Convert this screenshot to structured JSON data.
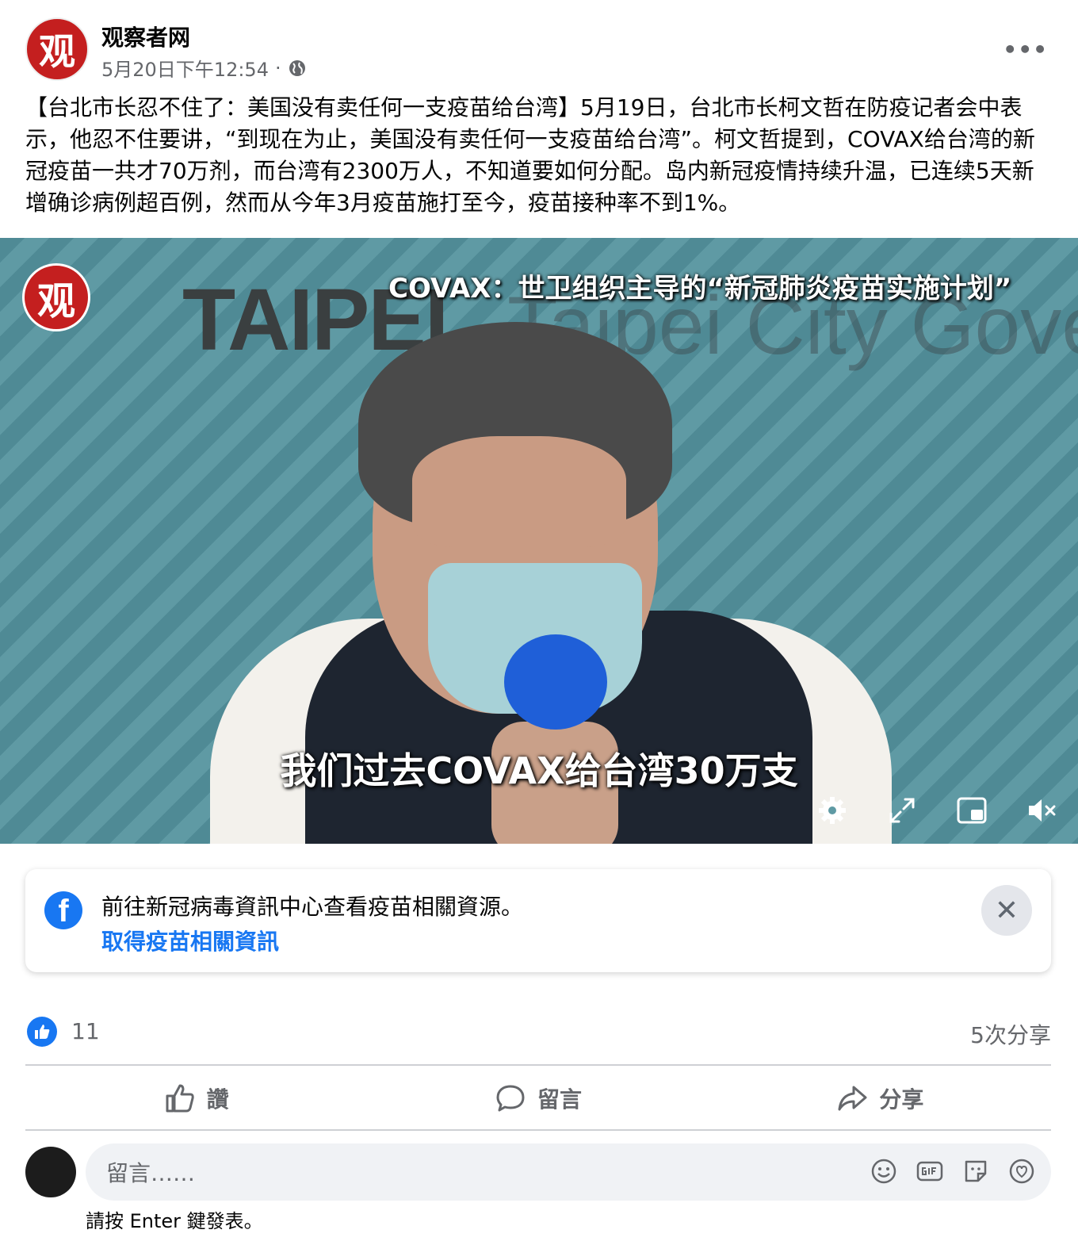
{
  "header": {
    "avatar_text": "观",
    "page_name": "观察者网",
    "timestamp": "5月20日下午12:54",
    "separator": "·",
    "privacy_icon": "globe-icon",
    "more_icon": "more-options-icon",
    "more_label": "•••"
  },
  "post": {
    "text": "【台北市长忍不住了：美国没有卖任何一支疫苗给台湾】5月19日，台北市长柯文哲在防疫记者会中表示，他忍不住要讲，“到现在为止，美国没有卖任何一支疫苗给台湾”。柯文哲提到，COVAX给台湾的新冠疫苗一共才70万剂，而台湾有2300万人，不知道要如何分配。岛内新冠疫情持续升温，已连续5天新增确诊病例超百例，然而从今年3月疫苗施打至今，疫苗接种率不到1%。"
  },
  "video": {
    "logo_text": "观",
    "backdrop_text": "TAIPEI",
    "backdrop_text_2": "Taipei City Gover",
    "top_caption": "COVAX：世卫组织主导的“新冠肺炎疫苗实施计划”",
    "subtitle": "我们过去COVAX给台湾30万支",
    "controls": [
      "settings-icon",
      "fullscreen-icon",
      "picture-in-picture-icon",
      "muted-volume-icon"
    ]
  },
  "info_card": {
    "text": "前往新冠病毒資訊中心查看疫苗相關資源。",
    "link": "取得疫苗相關資訊",
    "close_label": "✕",
    "logo_text": "f"
  },
  "stats": {
    "like_count": "11",
    "shares": "5次分享"
  },
  "actions": {
    "like": "讚",
    "comment": "留言",
    "share": "分享"
  },
  "comment": {
    "placeholder": "留言……",
    "hint": "請按 Enter 鍵發表。",
    "icons": [
      "emoji-icon",
      "gif-icon",
      "sticker-icon",
      "avatar-sticker-icon"
    ]
  },
  "colors": {
    "brand_blue": "#1877f2",
    "secondary_text": "#65676b",
    "logo_red": "#c41f1f"
  }
}
